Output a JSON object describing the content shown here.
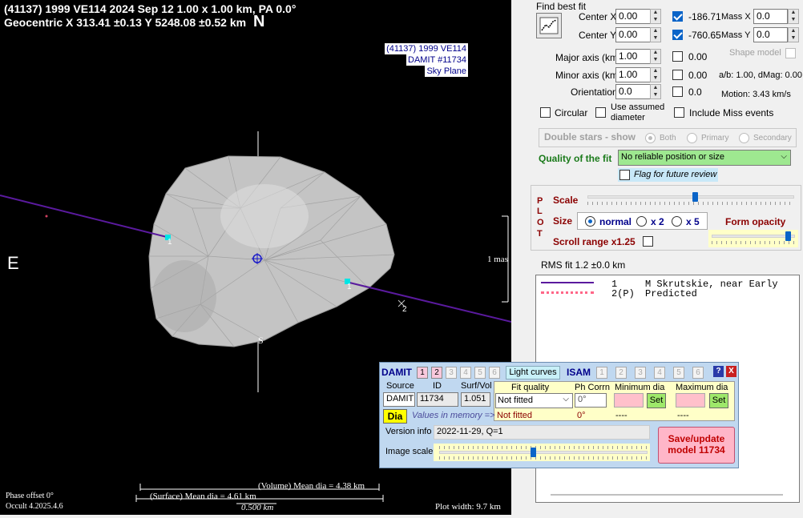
{
  "plot": {
    "header_line1": "(41137) 1999 VE114  2024 Sep 12  1.00 x 1.00 km, PA 0.0°",
    "header_line2": "Geocentric  X  313.41 ±0.13  Y 5248.08 ±0.52 km",
    "north": "N",
    "east": "E",
    "south": "S",
    "legend": [
      "(41137) 1999 VE114",
      "DAMIT #11734",
      "Sky Plane"
    ],
    "scale_label": "1 mas",
    "chord_labels": [
      "1",
      "1",
      "2"
    ],
    "volume_dia": "(Volume) Mean dia = 4.38 km",
    "surface_dia": "(Surface) Mean dia = 4.61 km",
    "scale_bar": "0.500 km",
    "phase_offset": "Phase offset 0°",
    "version": "Occult 4.2025.4.6",
    "plot_width": "Plot width: 9.7 km",
    "colors": {
      "background": "#000000",
      "chord": "#5a1a9e",
      "shape": "#bdbdbd",
      "marker": "#00e5e5"
    }
  },
  "fit": {
    "find_best_fit": "Find best fit",
    "fit_icon": "curve-fit-icon",
    "center_x_label": "Center X",
    "center_x": "0.00",
    "center_x_fit": "-186.71",
    "mass_x_label": "Mass X",
    "mass_x": "0.0",
    "center_y_label": "Center Y",
    "center_y": "0.00",
    "center_y_fit": "-760.65",
    "mass_y_label": "Mass Y",
    "mass_y": "0.0",
    "major_label": "Major axis (km)",
    "major": "1.00",
    "major_fit": "0.00",
    "shape_model": "Shape model",
    "minor_label": "Minor axis (km)",
    "minor": "1.00",
    "minor_fit": "0.00",
    "ab_info": "a/b: 1.00, dMag: 0.00",
    "orientation_label": "Orientation",
    "orientation": "0.0",
    "orientation_fit": "0.0",
    "motion": "Motion: 3.43 km/s",
    "circular": "Circular",
    "assumed_diameter": "Use assumed diameter",
    "include_miss": "Include Miss events"
  },
  "double_stars": {
    "title": "Double stars - show",
    "both": "Both",
    "primary": "Primary",
    "secondary": "Secondary"
  },
  "quality": {
    "label": "Quality of the fit",
    "value": "No reliable position or size",
    "flag": "Flag for future review"
  },
  "plot_panel": {
    "plot_letters": [
      "P",
      "L",
      "O",
      "T"
    ],
    "scale": "Scale",
    "scale_level": 0.52,
    "size": "Size",
    "size_normal": "normal",
    "size_x2": "x 2",
    "size_x5": "x 5",
    "form_opacity": "Form opacity",
    "opacity_level": 0.95,
    "scroll_range": "Scroll range x1.25"
  },
  "rms": "RMS fit  1.2 ±0.0 km",
  "observers": [
    {
      "num": "1",
      "name": "M Skrutskie, near Early"
    },
    {
      "num": "2(P)",
      "name": "Predicted"
    }
  ],
  "damit": {
    "title": "DAMIT",
    "model_buttons": [
      "1",
      "2",
      "3",
      "4",
      "5",
      "6"
    ],
    "light_curves": "Light curves",
    "isam": "ISAM",
    "isam_buttons": [
      "1",
      "2",
      "3",
      "4",
      "5",
      "6"
    ],
    "help": "?",
    "close": "X",
    "source_label": "Source",
    "source": "DAMIT",
    "id_label": "ID",
    "id": "11734",
    "surfvol_label": "Surf/Vol",
    "surfvol": "1.051",
    "fit_quality_label": "Fit quality",
    "fit_quality": "Not fitted",
    "fit_quality_mem": "Not fitted",
    "phcorr_label": "Ph Corrn",
    "phcorr": "0°",
    "phcorr_mem": "0°",
    "min_dia_label": "Minimum dia",
    "min_dia_mem": "----",
    "max_dia_label": "Maximum dia",
    "max_dia_mem": "----",
    "set": "Set",
    "dia_button": "Dia",
    "values_in_memory": "Values in memory =>",
    "version_label": "Version info",
    "version": "2022-11-29, Q=1",
    "image_scale_label": "Image scale",
    "image_scale_level": 0.45,
    "save_button": "Save/update model 11734"
  }
}
